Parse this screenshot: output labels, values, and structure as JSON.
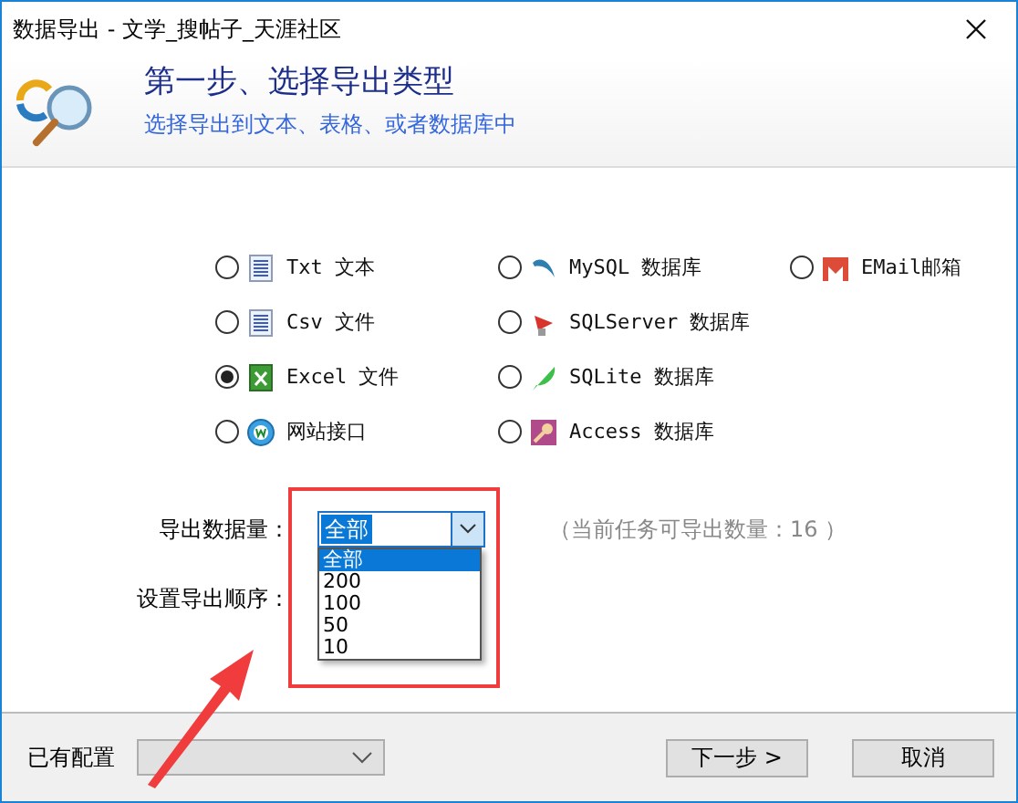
{
  "window": {
    "title": "数据导出 - 文学_搜帖子_天涯社区"
  },
  "header": {
    "title": "第一步、选择导出类型",
    "subtitle": "选择导出到文本、表格、或者数据库中"
  },
  "export_columns": [
    {
      "options": [
        {
          "label": "Txt 文本",
          "selected": false
        },
        {
          "label": "Csv 文件",
          "selected": false
        },
        {
          "label": "Excel 文件",
          "selected": true
        },
        {
          "label": "网站接口",
          "selected": false
        }
      ]
    },
    {
      "options": [
        {
          "label": "MySQL 数据库",
          "selected": false
        },
        {
          "label": "SQLServer 数据库",
          "selected": false
        },
        {
          "label": "SQLite 数据库",
          "selected": false
        },
        {
          "label": "Access 数据库",
          "selected": false
        }
      ]
    },
    {
      "options": [
        {
          "label": "EMail邮箱",
          "selected": false
        }
      ]
    }
  ],
  "quantity": {
    "label": "导出数据量：",
    "value": "全部",
    "note": "（当前任务可导出数量：16 ）",
    "expanded": true,
    "options": [
      {
        "label": "全部",
        "selected": true
      },
      {
        "label": "200",
        "selected": false
      },
      {
        "label": "100",
        "selected": false
      },
      {
        "label": "50",
        "selected": false
      },
      {
        "label": "10",
        "selected": false
      }
    ]
  },
  "order": {
    "label": "设置导出顺序："
  },
  "footer": {
    "config_label": "已有配置",
    "next_button": "下一步 >",
    "cancel_button": "取消"
  }
}
